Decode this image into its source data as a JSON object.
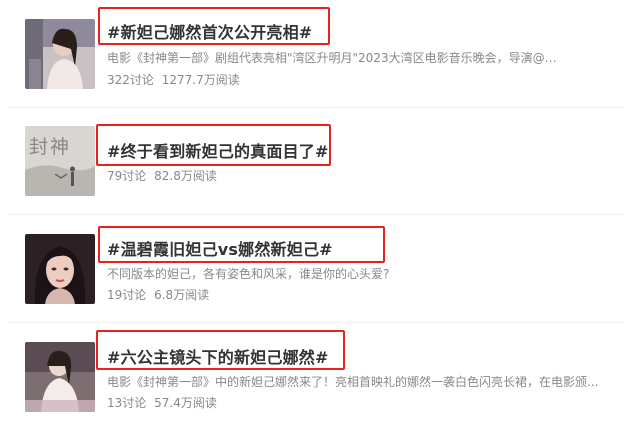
{
  "topics": [
    {
      "title": "#新妲己娜然首次公开亮相#",
      "description": "电影《封神第一部》剧组代表亮相\"湾区升明月\"2023大湾区电影音乐晚会，导演@乌...",
      "discussions": "322讨论",
      "reads": "1277.7万阅读",
      "thumbnail": "actress-photo"
    },
    {
      "title": "#终于看到新妲己的真面目了#",
      "description": "",
      "discussions": "79讨论",
      "reads": "82.8万阅读",
      "thumbnail": "film-poster",
      "thumbnail_text": "封神"
    },
    {
      "title": "#温碧霞旧妲己vs娜然新妲己#",
      "description": "不同版本的妲己，各有姿色和风采，谁是你的心头爱?",
      "discussions": "19讨论",
      "reads": "6.8万阅读",
      "thumbnail": "actress-portrait"
    },
    {
      "title": "#六公主镜头下的新妲己娜然#",
      "description": "电影《封神第一部》中的新妲己娜然来了！亮相首映礼的娜然一袭白色闪亮长裙，在电影颁...",
      "discussions": "13讨论",
      "reads": "57.4万阅读",
      "thumbnail": "event-photo"
    }
  ],
  "colors": {
    "highlight": "#e8231a",
    "title": "#333333",
    "secondary": "#888888"
  }
}
